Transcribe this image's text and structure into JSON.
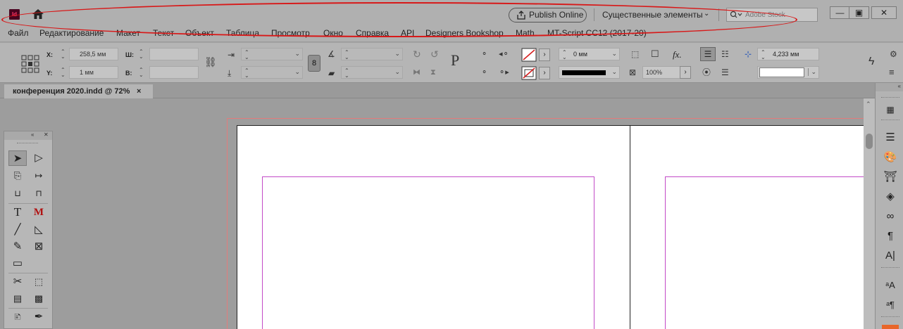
{
  "app": {
    "logo_text": "Id",
    "home_icon": "home-icon"
  },
  "appbar": {
    "publish_label": "Publish Online",
    "workspace_label": "Существенные элементы",
    "workspace_chevron": "⌄",
    "search_placeholder": "Adobe Stock",
    "window_buttons": {
      "minimize": "—",
      "restore": "▣",
      "close": "✕"
    }
  },
  "menu": [
    "Файл",
    "Редактирование",
    "Макет",
    "Текст",
    "Объект",
    "Таблица",
    "Просмотр",
    "Окно",
    "Справка",
    "API",
    "Designers Bookshop",
    "Math",
    "MT-Script CC12 (2017-20)"
  ],
  "control": {
    "x_label": "X:",
    "x_value": "258,5 мм",
    "y_label": "Y:",
    "y_value": "1 мм",
    "w_label": "Ш:",
    "w_value": "",
    "h_label": "В:",
    "h_value": "",
    "stroke_weight": "0 мм",
    "opacity": "100%",
    "gap_value": "4,233 мм",
    "fx_label": "fx."
  },
  "document_tab": {
    "title": "конференция 2020.indd @ 72%",
    "close": "×"
  },
  "colors": {
    "annotation": "#d81818",
    "bleed": "#e37b7b",
    "margin": "#c24ac7",
    "accent": "#e8662a"
  }
}
